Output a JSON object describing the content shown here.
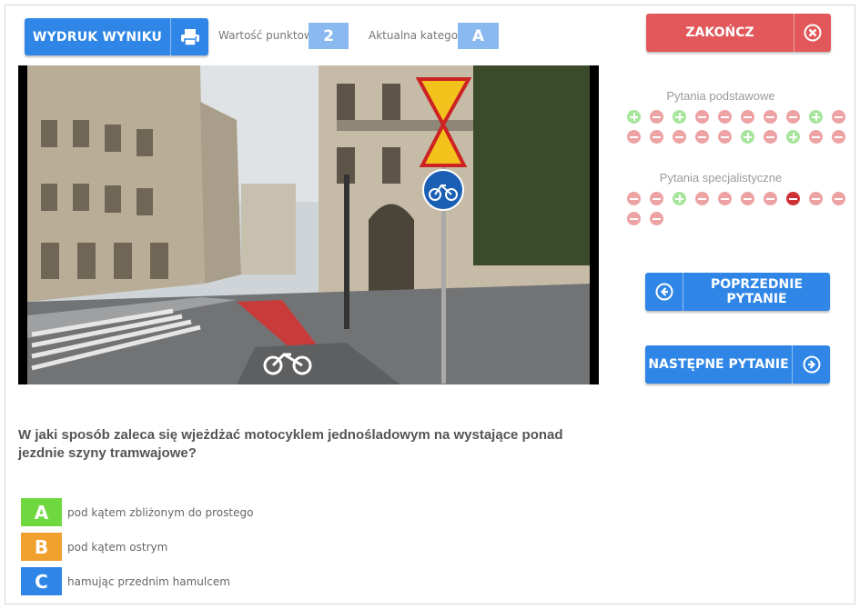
{
  "header": {
    "print_button_label": "WYDRUK WYNIKU",
    "points_label": "Wartość punktowa",
    "points_value": "2",
    "category_label": "Aktualna kategoria",
    "category_value": "A",
    "end_button_label": "ZAKOŃCZ"
  },
  "progress": {
    "basic_title": "Pytania podstawowe",
    "basic": [
      "correct",
      "wrong",
      "correct",
      "wrong",
      "wrong",
      "wrong",
      "wrong",
      "wrong",
      "correct",
      "wrong",
      "wrong",
      "wrong",
      "wrong",
      "wrong",
      "wrong",
      "correct",
      "wrong",
      "correct",
      "wrong",
      "wrong"
    ],
    "specialist_title": "Pytania specjalistyczne",
    "specialist": [
      "wrong",
      "wrong",
      "correct",
      "wrong",
      "wrong",
      "wrong",
      "wrong",
      "current",
      "wrong",
      "wrong",
      "wrong",
      "wrong"
    ]
  },
  "nav": {
    "prev_label": "POPRZEDNIE PYTANIE",
    "next_label": "NASTĘPNE PYTANIE"
  },
  "question": {
    "text": "W jaki sposób zaleca się wjeżdżać motocyklem jednośladowym na wystające ponad jezdnie szyny tramwajowe?",
    "answers": [
      {
        "letter": "A",
        "text": "pod kątem zbliżonym do prostego",
        "color": "#6fd83f"
      },
      {
        "letter": "B",
        "text": "pod kątem ostrym",
        "color": "#f0a02c"
      },
      {
        "letter": "C",
        "text": "hamując przednim hamulcem",
        "color": "#2f86e6"
      }
    ]
  },
  "colors": {
    "primary_blue": "#2f86e6",
    "end_red": "#e2585a",
    "value_badge": "#8ab9ef",
    "dot_green": "#a6e59b",
    "dot_red": "#eda2a3",
    "dot_current": "#cf3034"
  },
  "icons": {
    "print": "printer-icon",
    "end": "close-circle-icon",
    "prev": "arrow-left-circle-icon",
    "next": "arrow-right-circle-icon"
  }
}
